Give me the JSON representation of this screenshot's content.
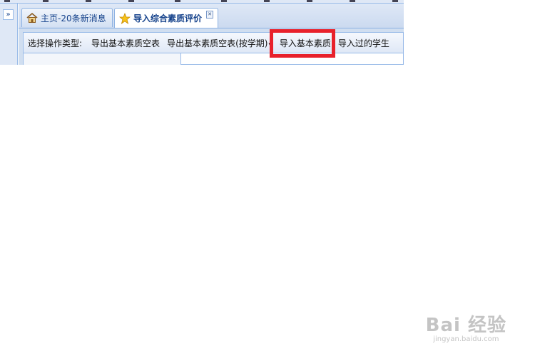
{
  "tabs": [
    {
      "label": "主页-20条新消息",
      "icon": "home-icon",
      "active": false
    },
    {
      "label": "导入综合素质评价",
      "icon": "star-icon",
      "active": true,
      "closable": true
    }
  ],
  "toolbar": {
    "label": "选择操作类型:",
    "buttons": [
      {
        "label": "导出基本素质空表",
        "has_menu": false
      },
      {
        "label": "导出基本素质空表(按学期)",
        "has_menu": true
      },
      {
        "label": "导入基本素质",
        "has_menu": false,
        "highlighted": true
      },
      {
        "label": "导入过的学生",
        "has_menu": false
      }
    ]
  },
  "highlight_color": "#e8212b",
  "accent_color": "#15428b",
  "watermark": {
    "main": "Bai 经验",
    "sub": "jingyan.baidu.com"
  }
}
